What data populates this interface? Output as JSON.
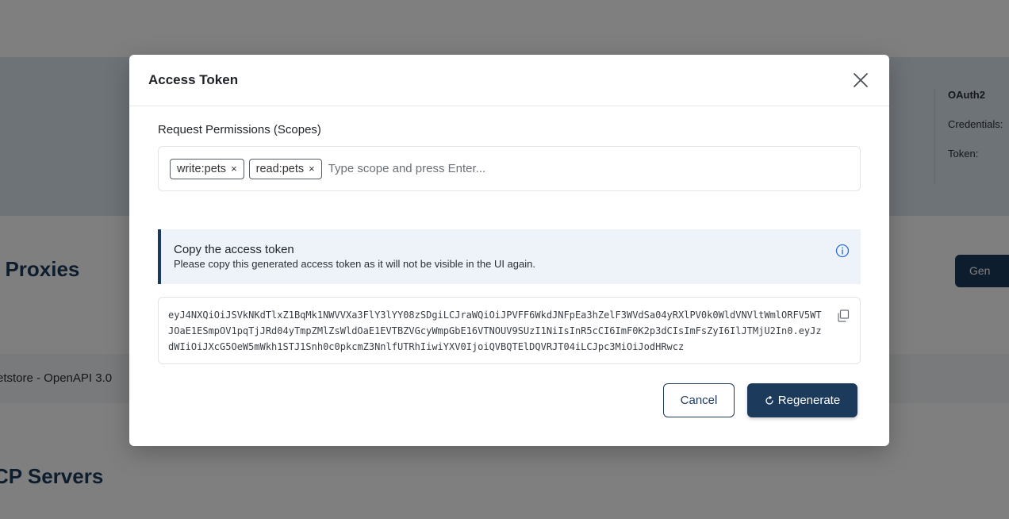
{
  "background": {
    "side_panel": {
      "title": "OAuth2",
      "credentials_label": "Credentials:",
      "token_label": "Token:"
    },
    "section_one_title": "I Proxies",
    "generate_button_label": "Gen",
    "row_text": "etstore - OpenAPI 3.0",
    "section_two_title": "CP Servers"
  },
  "modal": {
    "title": "Access Token",
    "scopes_label": "Request Permissions (Scopes)",
    "scopes": [
      {
        "label": "write:pets"
      },
      {
        "label": "read:pets"
      }
    ],
    "scope_input_placeholder": "Type scope and press Enter...",
    "alert": {
      "title": "Copy the access token",
      "description": "Please copy this generated access token as it will not be visible in the UI again."
    },
    "token": "eyJ4NXQiOiJSVkNKdTlxZ1BqMk1NWVVXa3FlY3lYY08zSDgiLCJraWQiOiJPVFF6WkdJNFpEa3hZelF3WVdSa04yRXlPV0k0WldVNVltWmlORFV5WTJOaE1ESmpOV1pqTjJRd04yTmpZMlZsWldOaE1EVTBZVGcyWmpGbE16VTNOUV9SUzI1NiIsInR5cCI6ImF0K2p3dCIsImFsZyI6IlJTMjU2In0.eyJzdWIiOiJXcG5OeW5mWkh1STJ1Snh0c0pkcmZ3NnlfUTRhIiwiYXV0IjoiQVBQTElDQVRJT04iLCJpc3MiOiJodHRwcz",
    "cancel_label": "Cancel",
    "regenerate_label": "Regenerate"
  },
  "colors": {
    "primary": "#1c3a5c",
    "overlay": "rgba(0,0,0,0.5)",
    "alert_bg": "#eef3fa",
    "info_icon": "#2f6fd1"
  }
}
